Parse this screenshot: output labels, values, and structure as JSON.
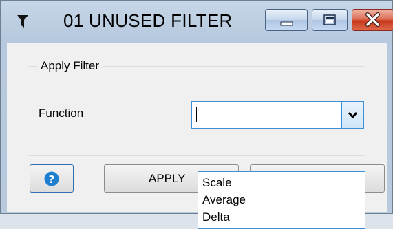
{
  "window": {
    "title": "01 UNUSED FILTER",
    "icon": "funnel-icon",
    "controls": [
      "minimize-icon",
      "maximize-icon",
      "close-icon"
    ]
  },
  "group": {
    "label": "Apply Filter"
  },
  "function_field": {
    "label": "Function",
    "value": "",
    "options": [
      "Scale",
      "Average",
      "Delta"
    ]
  },
  "buttons": {
    "help_icon": "question-icon",
    "apply_label": "APPLY"
  },
  "colors": {
    "focus_border": "#3f8fd5",
    "help_blue": "#1e7fd0",
    "close_red": "#c8371b"
  }
}
